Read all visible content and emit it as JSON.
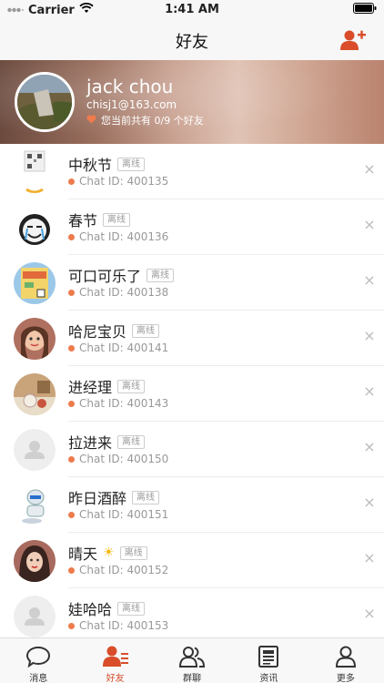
{
  "status_bar": {
    "carrier": "Carrier",
    "time": "1:41 AM"
  },
  "nav": {
    "title": "好友",
    "add_icon": "add-friend-icon",
    "accent": "#d94d2a"
  },
  "profile": {
    "name": "jack chou",
    "email": "chisj1@163.com",
    "count_text": "您当前共有 0/9 个好友"
  },
  "friends": [
    {
      "name": "中秋节",
      "status": "离线",
      "chat_id": "Chat ID: 400135"
    },
    {
      "name": "春节",
      "status": "离线",
      "chat_id": "Chat ID: 400136"
    },
    {
      "name": "可口可乐了",
      "status": "离线",
      "chat_id": "Chat ID: 400138"
    },
    {
      "name": "哈尼宝贝",
      "status": "离线",
      "chat_id": "Chat ID: 400141"
    },
    {
      "name": "进经理",
      "status": "离线",
      "chat_id": "Chat ID: 400143"
    },
    {
      "name": "拉进来",
      "status": "离线",
      "chat_id": "Chat ID: 400150"
    },
    {
      "name": "昨日酒醉",
      "status": "离线",
      "chat_id": "Chat ID: 400151"
    },
    {
      "name": "晴天",
      "status": "离线",
      "chat_id": "Chat ID: 400152",
      "emoji": "☀"
    },
    {
      "name": "娃哈哈",
      "status": "离线",
      "chat_id": "Chat ID: 400153"
    }
  ],
  "tabs": [
    {
      "label": "消息",
      "icon": "message-icon"
    },
    {
      "label": "好友",
      "icon": "friends-icon",
      "active": true
    },
    {
      "label": "群聊",
      "icon": "group-icon"
    },
    {
      "label": "资讯",
      "icon": "news-icon"
    },
    {
      "label": "更多",
      "icon": "more-icon"
    }
  ]
}
